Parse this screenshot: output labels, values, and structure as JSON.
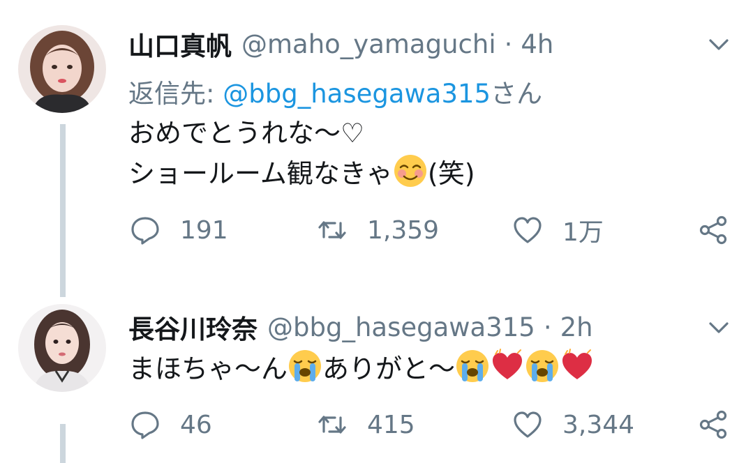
{
  "tweets": [
    {
      "display_name": "山口真帆",
      "handle": "@maho_yamaguchi",
      "separator": "·",
      "time": "4h",
      "reply_prefix": "返信先: ",
      "reply_mention": "@bbg_hasegawa315",
      "reply_suffix": "さん",
      "line1": "おめでとうれな〜♡",
      "line2_pre": "ショールーム観なきゃ",
      "line2_emoji": "smiling-face-with-smiling-eyes",
      "line2_post": "(笑)",
      "replies": "191",
      "retweets": "1,359",
      "likes": "1万",
      "avatar_icon": "avatar-photo",
      "colors": {
        "mention": "#1b95e0",
        "secondary": "#657786",
        "thread_line": "#ccd6dd"
      }
    },
    {
      "display_name": "長谷川玲奈",
      "handle": "@bbg_hasegawa315",
      "separator": "·",
      "time": "2h",
      "text_a": "まほちゃ〜ん",
      "text_b": "ありがと〜",
      "emoji_sequence": [
        "loudly-crying-face",
        "loudly-crying-face",
        "red-heart",
        "loudly-crying-face",
        "red-heart"
      ],
      "replies": "46",
      "retweets": "415",
      "likes": "3,344",
      "avatar_icon": "avatar-photo"
    }
  ]
}
